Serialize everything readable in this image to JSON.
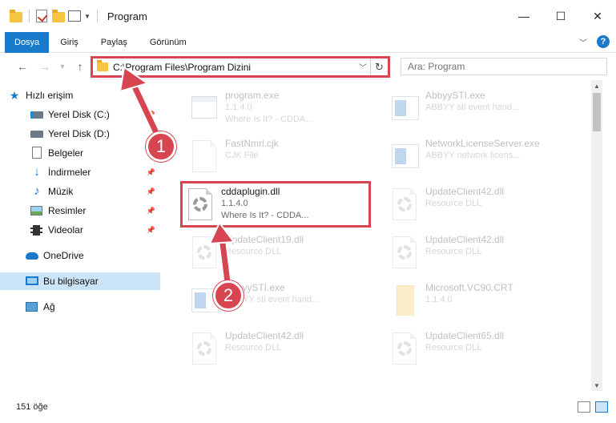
{
  "window": {
    "title": "Program",
    "controls": {
      "minimize": "—",
      "maximize": "☐",
      "close": "✕"
    }
  },
  "ribbon": {
    "tabs": [
      "Dosya",
      "Giriş",
      "Paylaş",
      "Görünüm"
    ],
    "help": "?"
  },
  "address": {
    "path": "C:\\Program Files\\Program Dizini",
    "search_placeholder": "Ara: Program"
  },
  "sidebar": {
    "items": [
      {
        "label": "Hızlı erişim",
        "icon": "star-icon"
      },
      {
        "label": "Yerel Disk (C:)",
        "icon": "drive-icon"
      },
      {
        "label": "Yerel Disk (D:)",
        "icon": "drive-icon"
      },
      {
        "label": "Belgeler",
        "icon": "document-icon"
      },
      {
        "label": "İndirmeler",
        "icon": "download-icon"
      },
      {
        "label": "Müzik",
        "icon": "music-icon"
      },
      {
        "label": "Resimler",
        "icon": "pictures-icon"
      },
      {
        "label": "Videolar",
        "icon": "video-icon"
      },
      {
        "label": "OneDrive",
        "icon": "cloud-icon"
      },
      {
        "label": "Bu bilgisayar",
        "icon": "computer-icon"
      },
      {
        "label": "Ağ",
        "icon": "network-icon"
      }
    ]
  },
  "files": [
    {
      "name": "program.exe",
      "sub1": "1.1.4.0",
      "sub2": "Where Is It? - CDDA...",
      "icon": "exe-icon"
    },
    {
      "name": "AbbyySTI.exe",
      "sub1": "ABBYY sti event hand...",
      "sub2": "",
      "icon": "app-icon"
    },
    {
      "name": "FastNmrl.cjk",
      "sub1": "CJK File",
      "sub2": "",
      "icon": "file-icon"
    },
    {
      "name": "NetworkLicenseServer.exe",
      "sub1": "ABBYY network licens...",
      "sub2": "",
      "icon": "app-icon"
    },
    {
      "name": "cddaplugin.dll",
      "sub1": "1.1.4.0",
      "sub2": "Where Is It? - CDDA...",
      "icon": "dll-icon"
    },
    {
      "name": "UpdateClient42.dll",
      "sub1": "Resource DLL",
      "sub2": "",
      "icon": "dll-icon"
    },
    {
      "name": "UpdateClient19.dll",
      "sub1": "Resource DLL",
      "sub2": "",
      "icon": "dll-icon"
    },
    {
      "name": "UpdateClient42.dll",
      "sub1": "Resource DLL",
      "sub2": "",
      "icon": "dll-icon"
    },
    {
      "name": "AbbyySTI.exe",
      "sub1": "ABBYY sti event hand...",
      "sub2": "",
      "icon": "app-icon"
    },
    {
      "name": "Microsoft.VC90.CRT",
      "sub1": "1.1.4.0",
      "sub2": "",
      "icon": "folder-zip-icon"
    },
    {
      "name": "UpdateClient42.dll",
      "sub1": "Resource DLL",
      "sub2": "",
      "icon": "dll-icon"
    },
    {
      "name": "UpdateClient65.dll",
      "sub1": "Resource DLL",
      "sub2": "",
      "icon": "dll-icon"
    }
  ],
  "annotations": [
    "1",
    "2"
  ],
  "status": {
    "count": "151 öğe"
  },
  "colors": {
    "accent": "#1979ca",
    "highlight": "#d64550",
    "selected": "#cce4f7"
  }
}
